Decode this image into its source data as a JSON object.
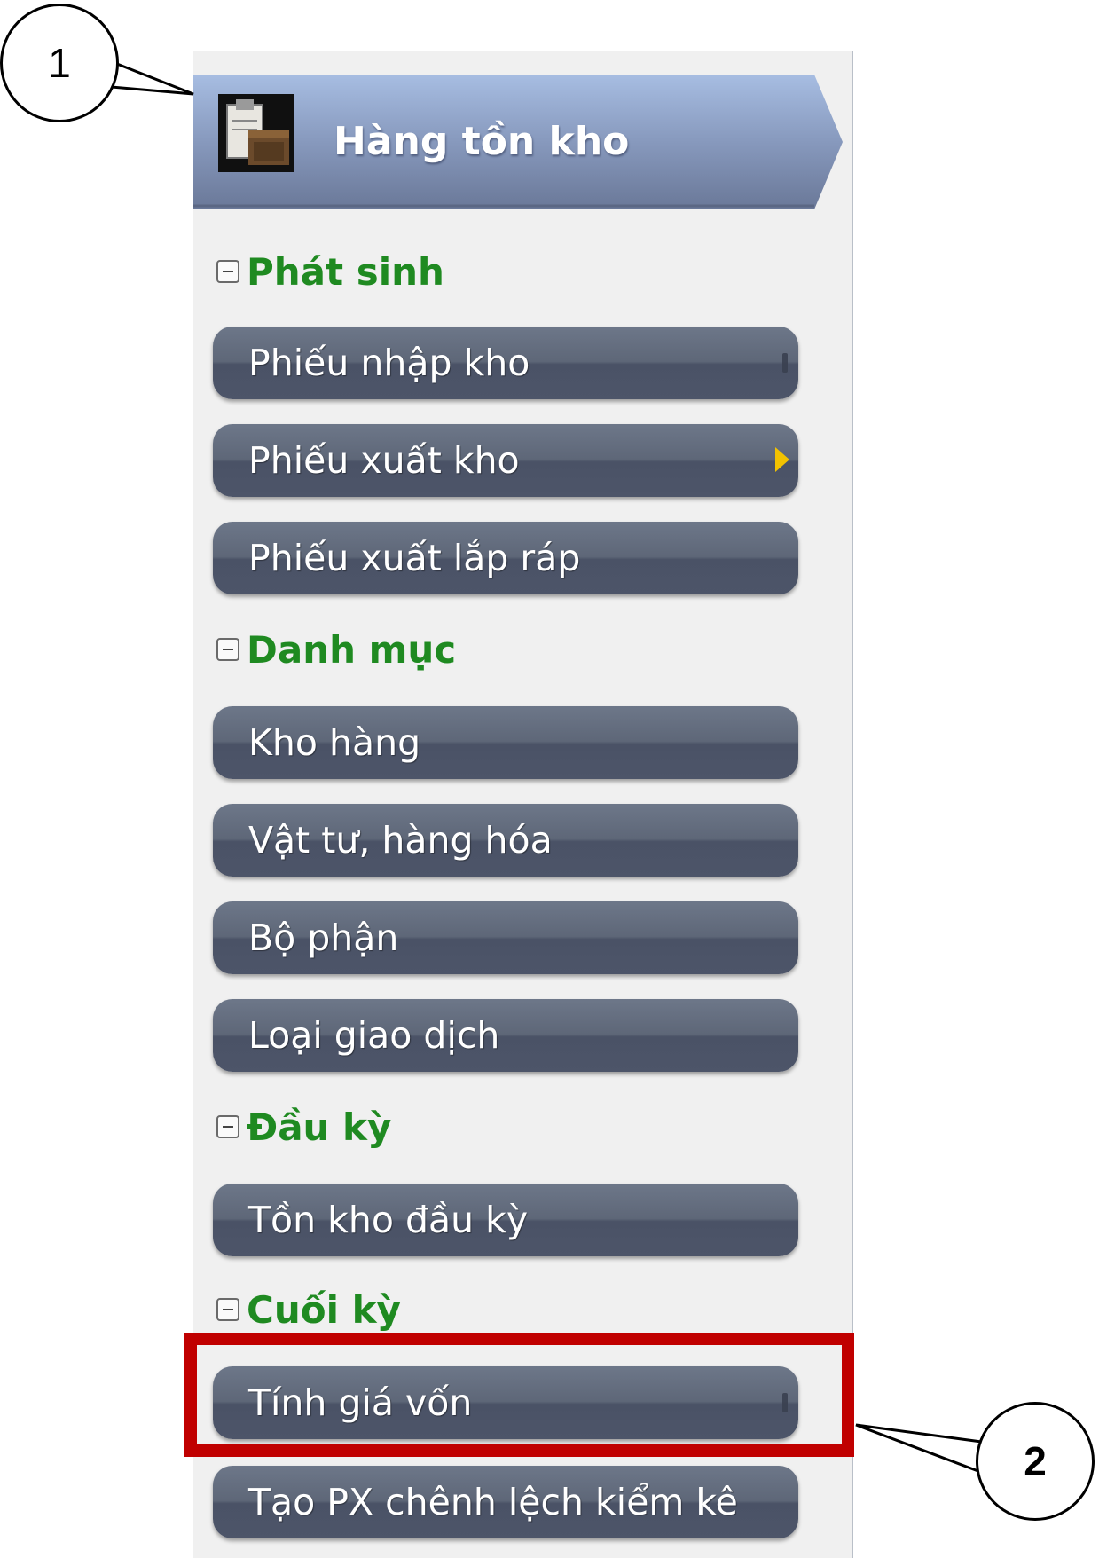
{
  "header": {
    "title": "Hàng tồn kho",
    "icon": "inventory-clipboard-box-icon"
  },
  "sections": [
    {
      "label": "Phát sinh"
    },
    {
      "label": "Danh mục"
    },
    {
      "label": "Đầu kỳ"
    },
    {
      "label": "Cuối kỳ"
    }
  ],
  "items": [
    {
      "label": "Phiếu nhập kho"
    },
    {
      "label": "Phiếu xuất kho"
    },
    {
      "label": "Phiếu xuất lắp ráp"
    },
    {
      "label": "Kho hàng"
    },
    {
      "label": "Vật tư, hàng hóa"
    },
    {
      "label": "Bộ phận"
    },
    {
      "label": "Loại giao dịch"
    },
    {
      "label": "Tồn kho đầu kỳ"
    },
    {
      "label": "Tính giá vốn"
    },
    {
      "label": "Tạo PX chênh lệch kiểm kê"
    }
  ],
  "callouts": [
    {
      "label": "1"
    },
    {
      "label": "2"
    }
  ],
  "colors": {
    "section_text": "#1f8a21",
    "item_bg": "#5e6778",
    "highlight": "#c00000",
    "submenu_arrow": "#f2c200"
  }
}
